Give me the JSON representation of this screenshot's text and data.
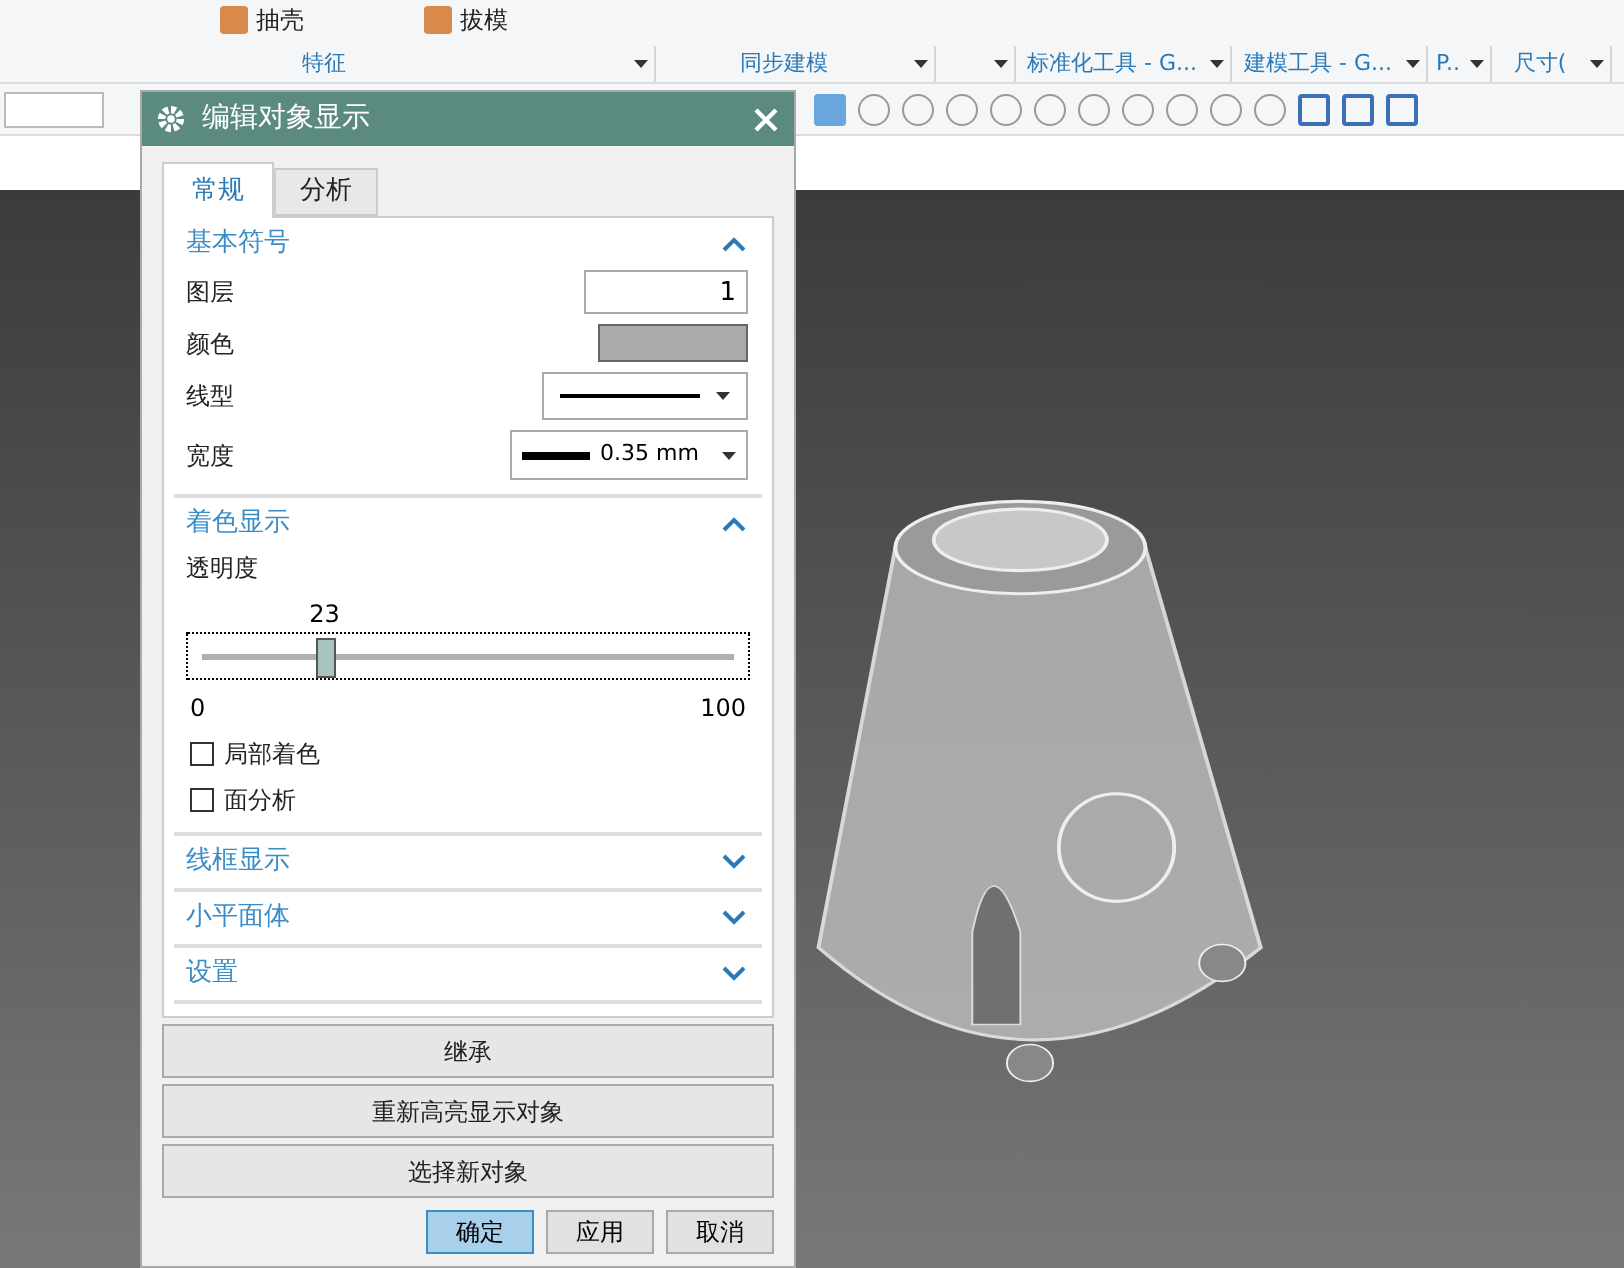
{
  "ribbon": {
    "commands": [
      {
        "label": "抽壳"
      },
      {
        "label": "拔模"
      }
    ],
    "groups": [
      {
        "label": "特征",
        "has_menu": true
      },
      {
        "label": "同步建模",
        "has_menu": true
      },
      {
        "has_menu": true
      },
      {
        "label": "标准化工具 - G...",
        "has_menu": true
      },
      {
        "label": "建模工具 - G...",
        "has_menu": true
      },
      {
        "label": "P..",
        "has_menu": true
      },
      {
        "label": "尺寸(",
        "has_menu": true
      }
    ]
  },
  "dialog": {
    "title": "编辑对象显示",
    "tabs": [
      {
        "label": "常规",
        "selected": true
      },
      {
        "label": "分析",
        "selected": false
      }
    ],
    "sections": [
      {
        "title": "基本符号",
        "expanded": true,
        "kind": "symbols",
        "layer_label": "图层",
        "layer_value": "1",
        "color_label": "颜色",
        "color": "#aaaaaa",
        "linetype_label": "线型",
        "width_label": "宽度",
        "width_value": "0.35 mm"
      },
      {
        "title": "着色显示",
        "expanded": true,
        "kind": "shading",
        "slider_label": "透明度",
        "reading": "23",
        "level": 0.23,
        "min": "0",
        "max": "100",
        "checkboxes": [
          {
            "label": "局部着色",
            "checked": false
          },
          {
            "label": "面分析",
            "checked": false
          }
        ]
      },
      {
        "title": "线框显示",
        "expanded": false
      },
      {
        "title": "小平面体",
        "expanded": false
      },
      {
        "title": "设置",
        "expanded": false
      }
    ],
    "actions": [
      "继承",
      "重新高亮显示对象",
      "选择新对象"
    ],
    "footer_buttons": [
      {
        "label": "确定",
        "default": true
      },
      {
        "label": "应用",
        "default": false
      },
      {
        "label": "取消",
        "default": false
      }
    ]
  }
}
